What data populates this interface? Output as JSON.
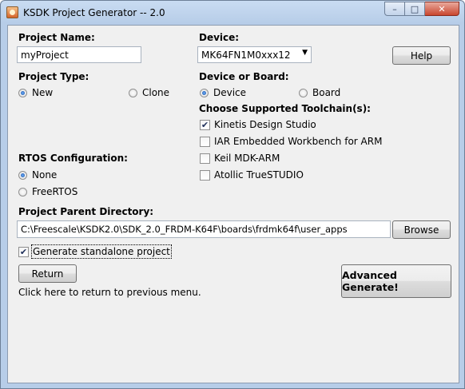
{
  "window": {
    "title": "KSDK Project Generator -- 2.0",
    "controls": {
      "minimize": "–",
      "maximize": "□",
      "close": "✕"
    }
  },
  "project_name": {
    "label": "Project Name:",
    "value": "myProject"
  },
  "device": {
    "label": "Device:",
    "selected": "MK64FN1M0xxx12"
  },
  "help_button": "Help",
  "project_type": {
    "label": "Project Type:",
    "options": [
      {
        "label": "New",
        "selected": true
      },
      {
        "label": "Clone",
        "selected": false
      }
    ]
  },
  "device_or_board": {
    "label": "Device or Board:",
    "options": [
      {
        "label": "Device",
        "selected": true
      },
      {
        "label": "Board",
        "selected": false
      }
    ]
  },
  "toolchains": {
    "label": "Choose Supported Toolchain(s):",
    "items": [
      {
        "label": "Kinetis Design Studio",
        "checked": true
      },
      {
        "label": "IAR Embedded Workbench for ARM",
        "checked": false
      },
      {
        "label": "Keil MDK-ARM",
        "checked": false
      },
      {
        "label": "Atollic TrueSTUDIO",
        "checked": false
      }
    ]
  },
  "rtos": {
    "label": "RTOS Configuration:",
    "options": [
      {
        "label": "None",
        "selected": true
      },
      {
        "label": "FreeRTOS",
        "selected": false
      }
    ]
  },
  "parent_directory": {
    "label": "Project Parent Directory:",
    "value": "C:\\Freescale\\KSDK2.0\\SDK_2.0_FRDM-K64F\\boards\\frdmk64f\\user_apps",
    "browse": "Browse"
  },
  "standalone": {
    "label": "Generate standalone project",
    "checked": true
  },
  "return_button": "Return",
  "return_hint": "Click here to return to previous menu.",
  "advanced_button": "Advanced Generate!"
}
